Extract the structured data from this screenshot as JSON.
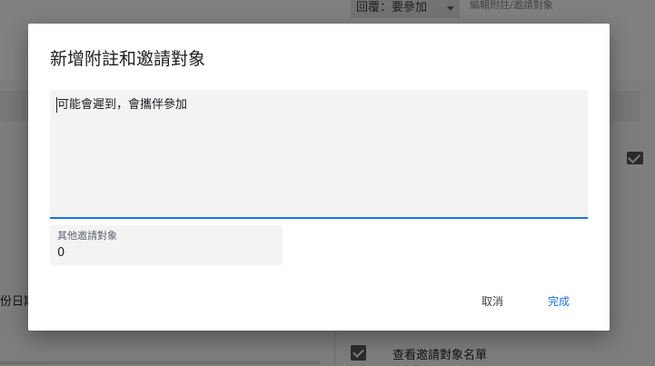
{
  "background": {
    "rsvp_label": "回覆：要參加",
    "edit_label": "編輯附註/邀請對象",
    "left_fragment": "份日期",
    "checkbox_label": "查看邀請對象名單"
  },
  "dialog": {
    "title": "新增附註和邀請對象",
    "note": {
      "value": "可能會遲到，會攜伴參加"
    },
    "guests": {
      "label": "其他邀請對象",
      "value": "0"
    },
    "cancel_label": "取消",
    "done_label": "完成"
  },
  "colors": {
    "accent": "#1a73e8",
    "overlay": "#7d7d7d"
  }
}
